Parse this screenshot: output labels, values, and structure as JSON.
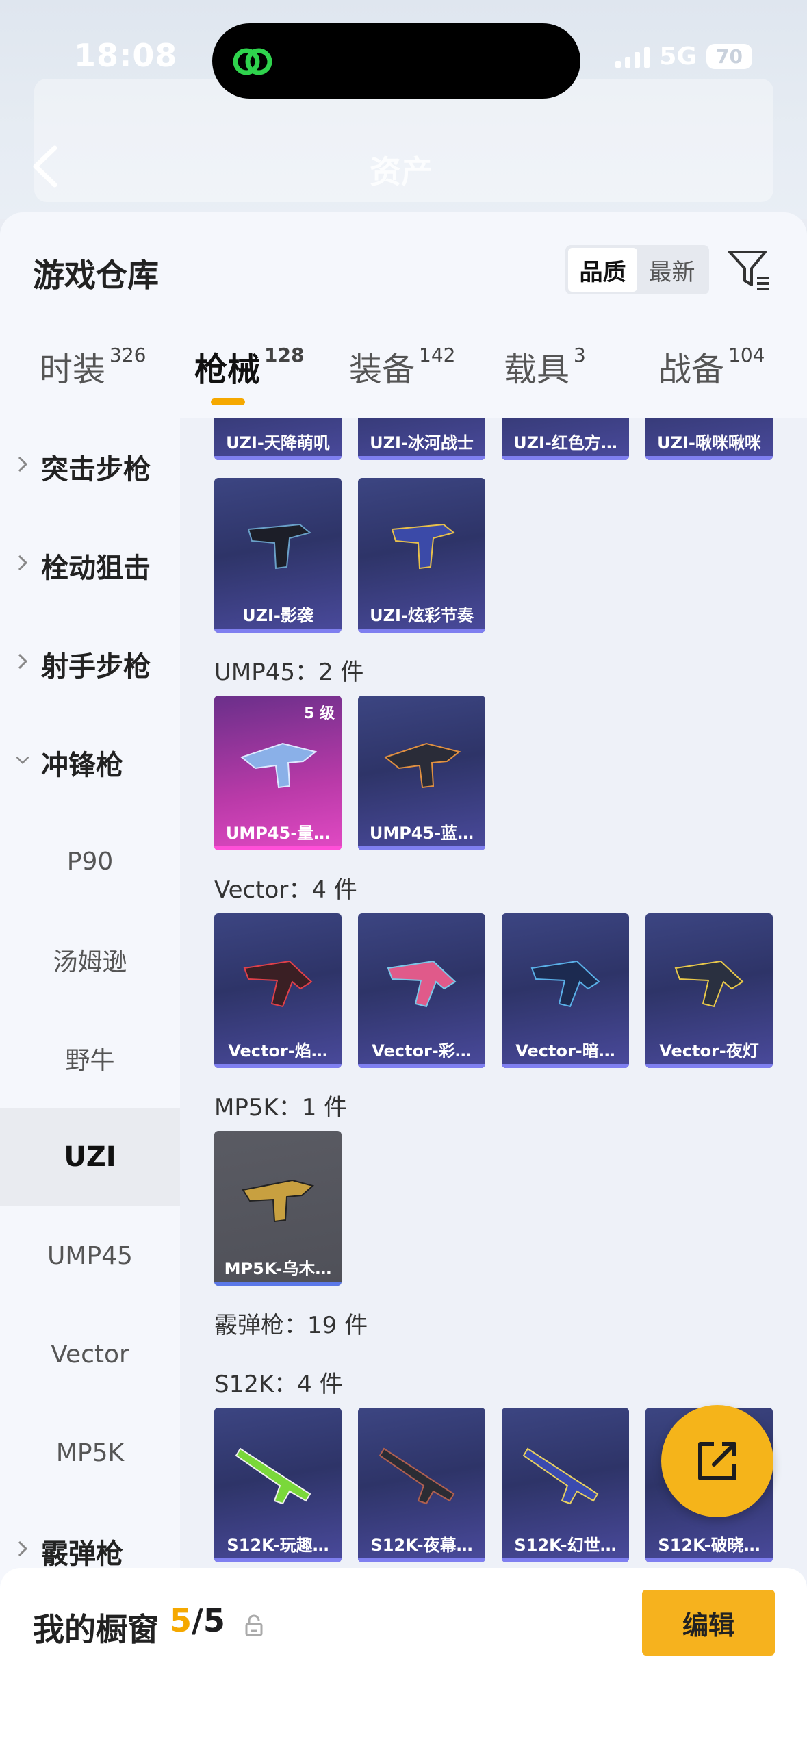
{
  "status_bar": {
    "time": "18:08",
    "network": "5G",
    "battery": "70"
  },
  "header": {
    "title": "资产"
  },
  "sheet": {
    "title": "游戏仓库",
    "sort": {
      "options": [
        "品质",
        "最新"
      ],
      "selected": "品质"
    }
  },
  "tabs": [
    {
      "label": "时装",
      "count": "326"
    },
    {
      "label": "枪械",
      "count": "128",
      "active": true
    },
    {
      "label": "装备",
      "count": "142"
    },
    {
      "label": "载具",
      "count": "3"
    },
    {
      "label": "战备",
      "count": "104"
    }
  ],
  "nav": {
    "items": [
      {
        "label": "突击步枪",
        "type": "category",
        "expanded": false
      },
      {
        "label": "栓动狙击",
        "type": "category",
        "expanded": false
      },
      {
        "label": "射手步枪",
        "type": "category",
        "expanded": false
      },
      {
        "label": "冲锋枪",
        "type": "category",
        "expanded": true
      },
      {
        "label": "P90",
        "type": "sub"
      },
      {
        "label": "汤姆逊",
        "type": "sub"
      },
      {
        "label": "野牛",
        "type": "sub"
      },
      {
        "label": "UZI",
        "type": "sub",
        "selected": true
      },
      {
        "label": "UMP45",
        "type": "sub"
      },
      {
        "label": "Vector",
        "type": "sub"
      },
      {
        "label": "MP5K",
        "type": "sub"
      },
      {
        "label": "霰弹枪",
        "type": "category",
        "expanded": false
      }
    ]
  },
  "content": {
    "uzi_partial": [
      "UZI-天降萌叽",
      "UZI-冰河战士",
      "UZI-红色方…",
      "UZI-啾咪啾咪"
    ],
    "uzi_row2": [
      "UZI-影袭",
      "UZI-炫彩节奏"
    ],
    "ump45_title": "UMP45：2 件",
    "ump45": [
      {
        "label": "UMP45-量…",
        "badge": "5 级"
      },
      {
        "label": "UMP45-蓝…"
      }
    ],
    "vector_title": "Vector：4 件",
    "vector": [
      "Vector-焰…",
      "Vector-彩…",
      "Vector-暗…",
      "Vector-夜灯"
    ],
    "mp5k_title": "MP5K：1 件",
    "mp5k": [
      "MP5K-乌木…"
    ],
    "shotgun_title": "霰弹枪：19 件",
    "s12k_title": "S12K：4 件",
    "s12k": [
      "S12K-玩趣…",
      "S12K-夜幕…",
      "S12K-幻世…",
      "S12K-破晓…"
    ]
  },
  "bottom": {
    "title": "我的橱窗",
    "count_current": "5",
    "count_total": "/5",
    "edit_label": "编辑"
  },
  "colors": {
    "accent": "#f5a800",
    "card_purple": "#2e3468",
    "card_pink": "#e24ac4"
  }
}
